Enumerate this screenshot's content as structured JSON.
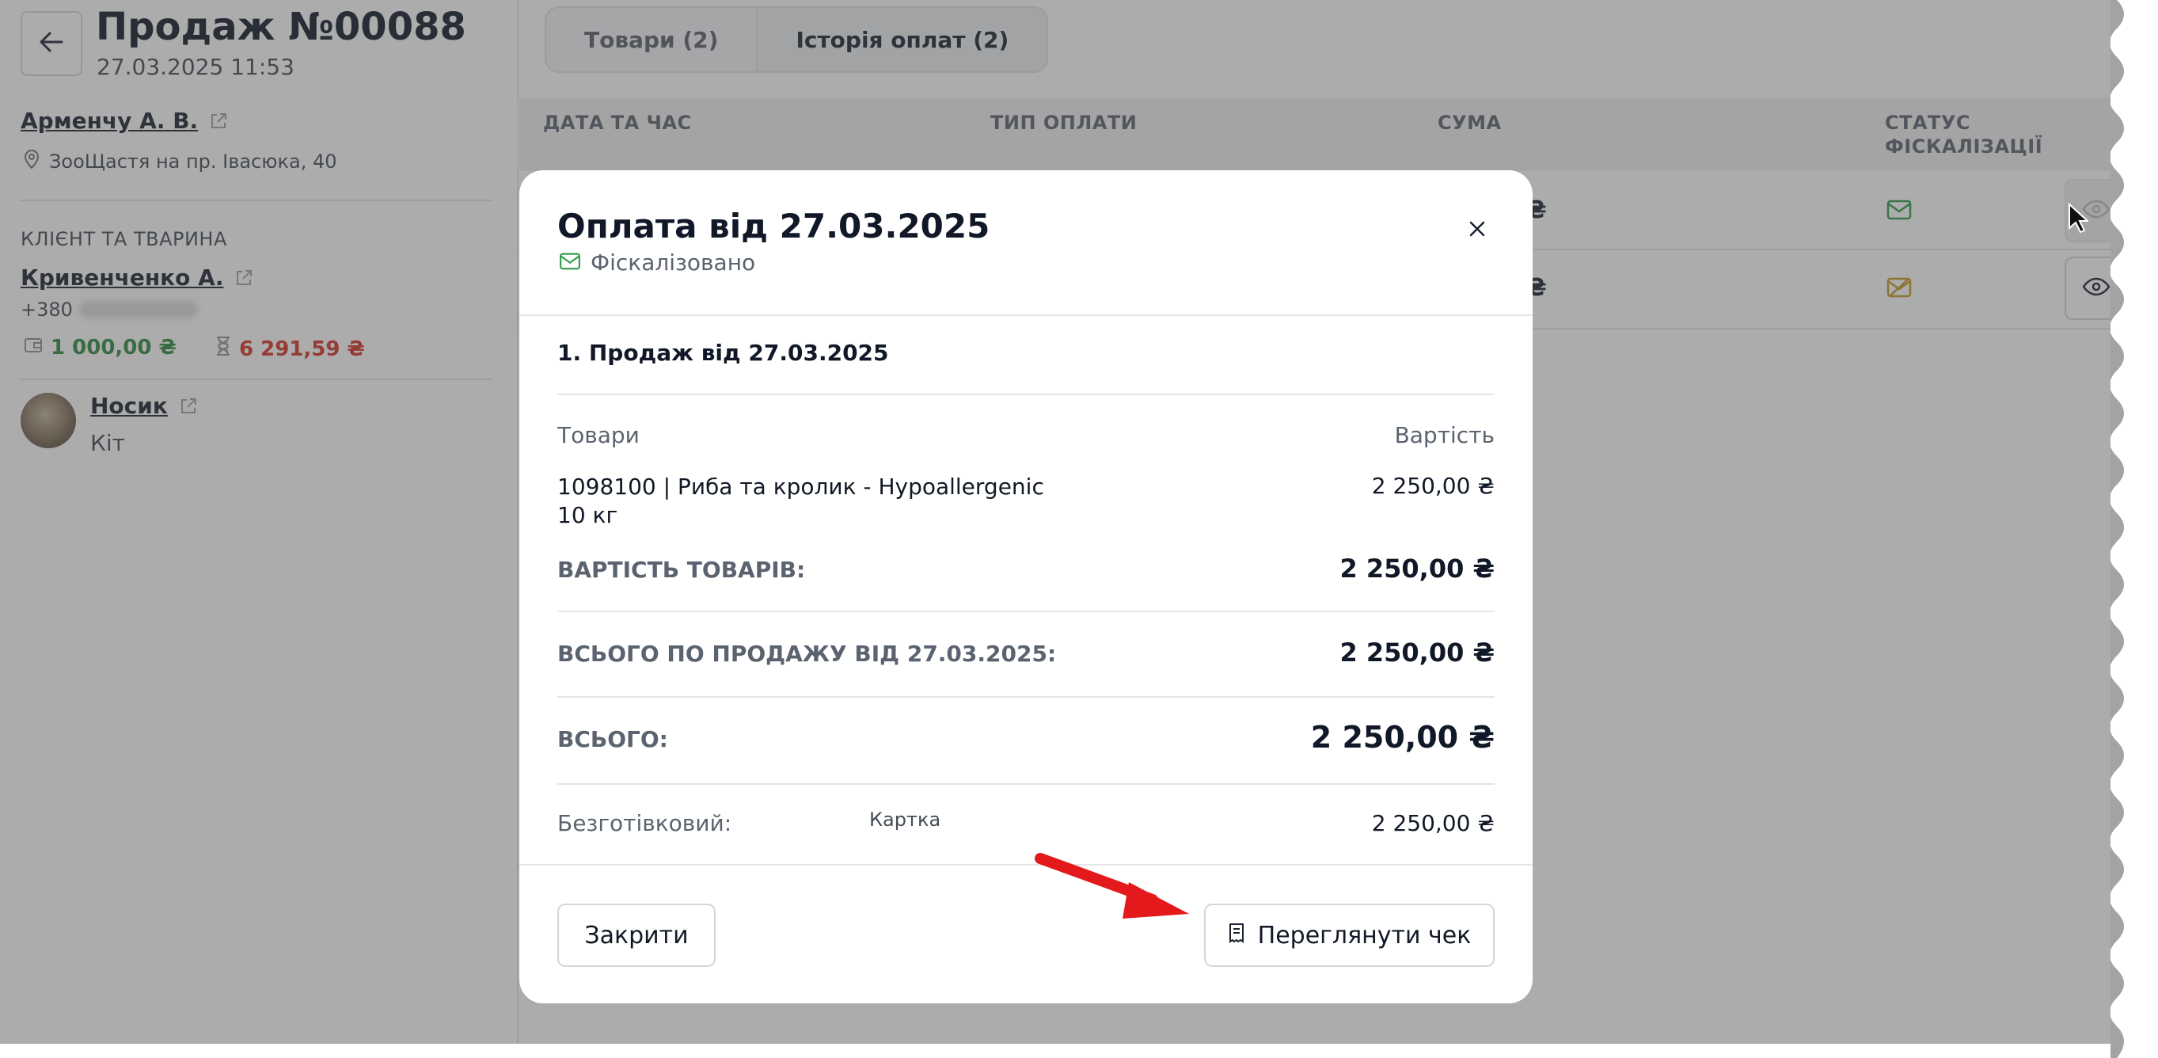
{
  "sale": {
    "title": "Продаж №00088",
    "datetime": "27.03.2025 11:53",
    "seller_name": "Арменчу А. В.",
    "location": "ЗооЩастя на пр. Івасюка, 40",
    "client_section_label": "КЛІЄНТ ТА ТВАРИНА",
    "client_name": "Кривенченко А.",
    "client_phone_prefix": "+380",
    "balance_positive": "1 000,00 ₴",
    "balance_pending": "6 291,59 ₴",
    "pet_name": "Носик",
    "pet_kind": "Кіт"
  },
  "tabs": [
    {
      "label": "Товари (2)",
      "active": false
    },
    {
      "label": "Історія оплат (2)",
      "active": true
    }
  ],
  "table": {
    "headers": {
      "datetime": "ДАТА ТА ЧАС",
      "payment_type": "ТИП ОПЛАТИ",
      "amount": "СУМА",
      "status_line1": "СТАТУС",
      "status_line2": "ФІСКАЛІЗАЦІЇ"
    },
    "rows": [
      {
        "amount_tail": "₴",
        "fiscal_status": "fiscalized",
        "fiscal_color": "#2e9b4a"
      },
      {
        "amount_tail": "₴",
        "fiscal_status": "not-fiscalized",
        "fiscal_color": "#c79a1f"
      }
    ]
  },
  "modal": {
    "title": "Оплата від 27.03.2025",
    "status": "Фіскалізовано",
    "status_color": "#2e9b4a",
    "section_title": "1. Продаж від 27.03.2025",
    "col_goods": "Товари",
    "col_cost": "Вартість",
    "item_name": "1098100 | Риба та кролик - Hypoallergenic 10 кг",
    "item_price": "2 250,00 ₴",
    "goods_total_label": "ВАРТІСТЬ ТОВАРІВ:",
    "goods_total_value": "2 250,00 ₴",
    "sale_total_label": "ВСЬОГО ПО ПРОДАЖУ ВІД 27.03.2025:",
    "sale_total_value": "2 250,00 ₴",
    "grand_total_label": "ВСЬОГО:",
    "grand_total_value": "2 250,00 ₴",
    "payment_label": "Безготівковий:",
    "payment_method": "Картка",
    "payment_value": "2 250,00 ₴",
    "close_button": "Закрити",
    "receipt_button": "Переглянути чек"
  },
  "annotation": {
    "arrow_color": "#e3191c"
  }
}
